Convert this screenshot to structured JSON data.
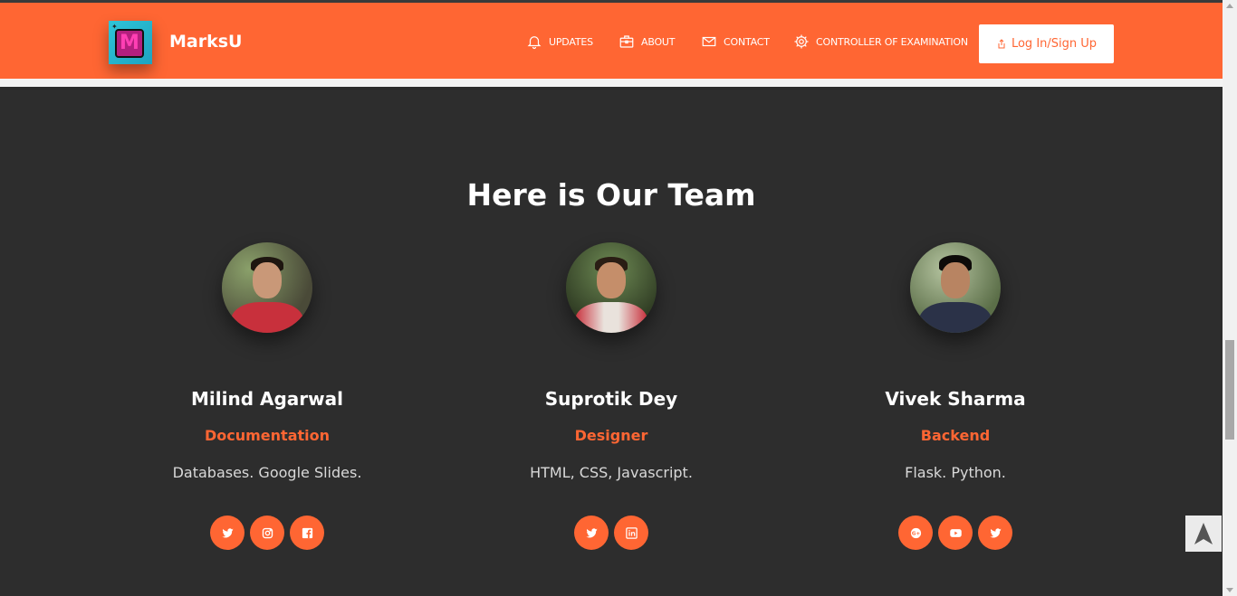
{
  "brand": {
    "name": "MarksU",
    "logo_letter": "M"
  },
  "nav": {
    "items": [
      {
        "label": "UPDATES",
        "icon": "bell-icon"
      },
      {
        "label": "ABOUT",
        "icon": "briefcase-icon"
      },
      {
        "label": "CONTACT",
        "icon": "envelope-icon"
      },
      {
        "label": "CONTROLLER OF EXAMINATION",
        "icon": "gear-icon"
      }
    ],
    "login_label": "Log In/Sign Up"
  },
  "team": {
    "title": "Here is Our Team",
    "members": [
      {
        "name": "Milind Agarwal",
        "role": "Documentation",
        "desc": "Databases. Google Slides.",
        "socials": [
          "twitter-icon",
          "instagram-icon",
          "facebook-icon"
        ]
      },
      {
        "name": "Suprotik Dey",
        "role": "Designer",
        "desc": "HTML, CSS, Javascript.",
        "socials": [
          "twitter-icon",
          "linkedin-icon"
        ]
      },
      {
        "name": "Vivek Sharma",
        "role": "Backend",
        "desc": "Flask. Python.",
        "socials": [
          "google-plus-icon",
          "youtube-icon",
          "twitter-icon"
        ]
      }
    ]
  },
  "colors": {
    "accent": "#ff6633",
    "background": "#2d2d2d",
    "text": "#ffffff"
  }
}
